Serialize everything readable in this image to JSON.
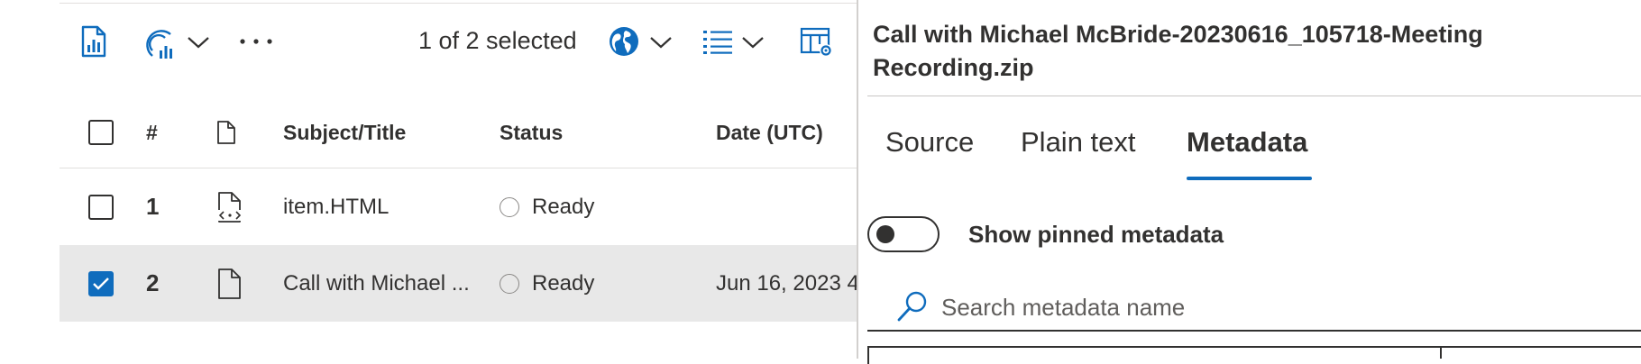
{
  "toolbar": {
    "selection_count": "1 of 2 selected",
    "icons": [
      "report-icon",
      "chart-icon",
      "chevron-down-icon",
      "more-icon",
      "globe-icon",
      "list-icon",
      "table-settings-icon"
    ]
  },
  "table": {
    "headers": {
      "number": "#",
      "file": "",
      "subject": "Subject/Title",
      "status": "Status",
      "date": "Date (UTC)"
    },
    "rows": [
      {
        "number": "1",
        "subject": "item.HTML",
        "status": "Ready",
        "date": "",
        "selected": false
      },
      {
        "number": "2",
        "subject": "Call with Michael ...",
        "status": "Ready",
        "date": "Jun 16, 2023 4:",
        "selected": true
      }
    ]
  },
  "detail": {
    "title": "Call with Michael McBride-20230616_105718-Meeting Recording.zip",
    "tabs": [
      "Source",
      "Plain text",
      "Metadata"
    ],
    "active_tab": "Metadata",
    "toggle_label": "Show pinned metadata",
    "toggle_on": false,
    "search_placeholder": "Search metadata name"
  },
  "colors": {
    "accent": "#0f6cbd",
    "selected_row": "#e8e8e8",
    "text": "#323130"
  }
}
